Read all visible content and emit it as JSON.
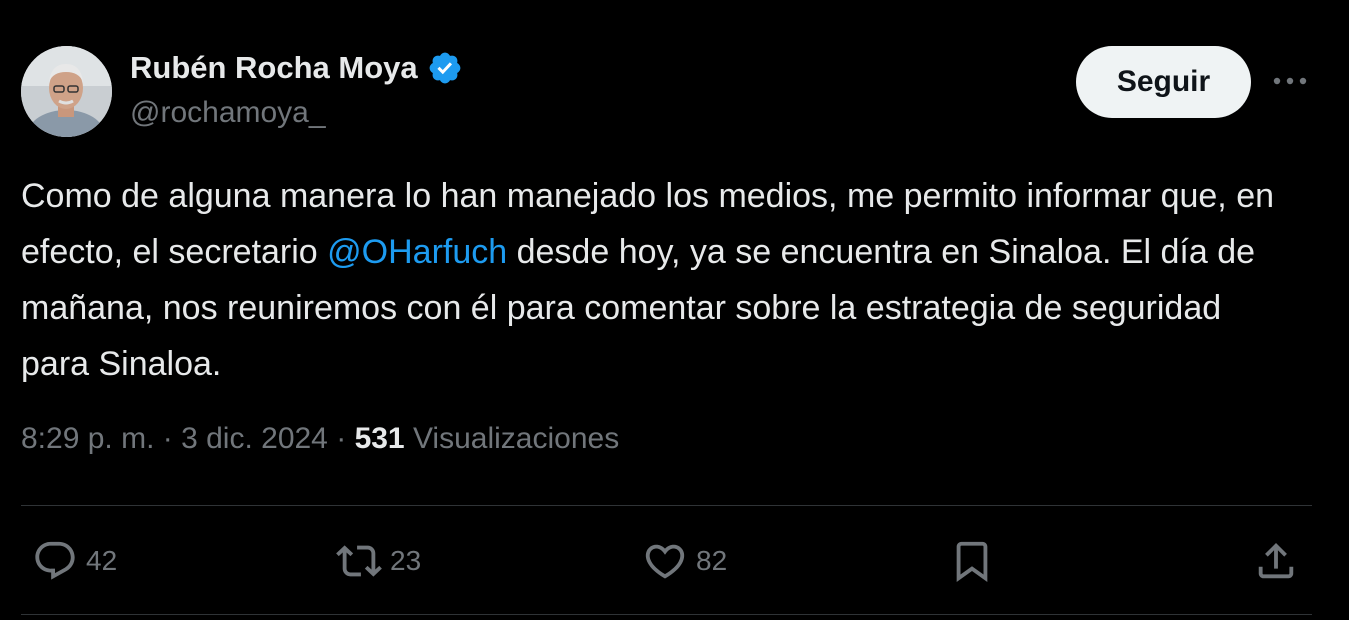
{
  "author": {
    "name": "Rubén Rocha Moya",
    "handle": "@rochamoya_",
    "verified_color": "#1d9bf0"
  },
  "follow_button": {
    "label": "Seguir"
  },
  "more_button": {
    "icon": "more-horizontal-icon"
  },
  "tweet": {
    "text_part1": "Como de alguna manera lo han manejado los medios, me permito informar que, en efecto, el secretario ",
    "mention": "@OHarfuch",
    "text_part2": " desde hoy, ya se encuentra en Sinaloa. El día de mañana, nos reuniremos con él para comentar sobre la estrategia de seguridad para Sinaloa."
  },
  "meta": {
    "time": "8:29 p. m.",
    "separator": "·",
    "date": "3 dic. 2024",
    "views_count": "531",
    "views_label": "Visualizaciones"
  },
  "actions": {
    "reply": {
      "icon": "reply-icon",
      "count": "42"
    },
    "repost": {
      "icon": "repost-icon",
      "count": "23"
    },
    "like": {
      "icon": "heart-icon",
      "count": "82"
    },
    "bookmark": {
      "icon": "bookmark-icon"
    },
    "share": {
      "icon": "share-icon"
    }
  },
  "colors": {
    "background": "#000000",
    "text": "#e7e9ea",
    "secondary": "#71767b",
    "accent": "#1d9bf0",
    "button_bg": "#eff3f4"
  }
}
